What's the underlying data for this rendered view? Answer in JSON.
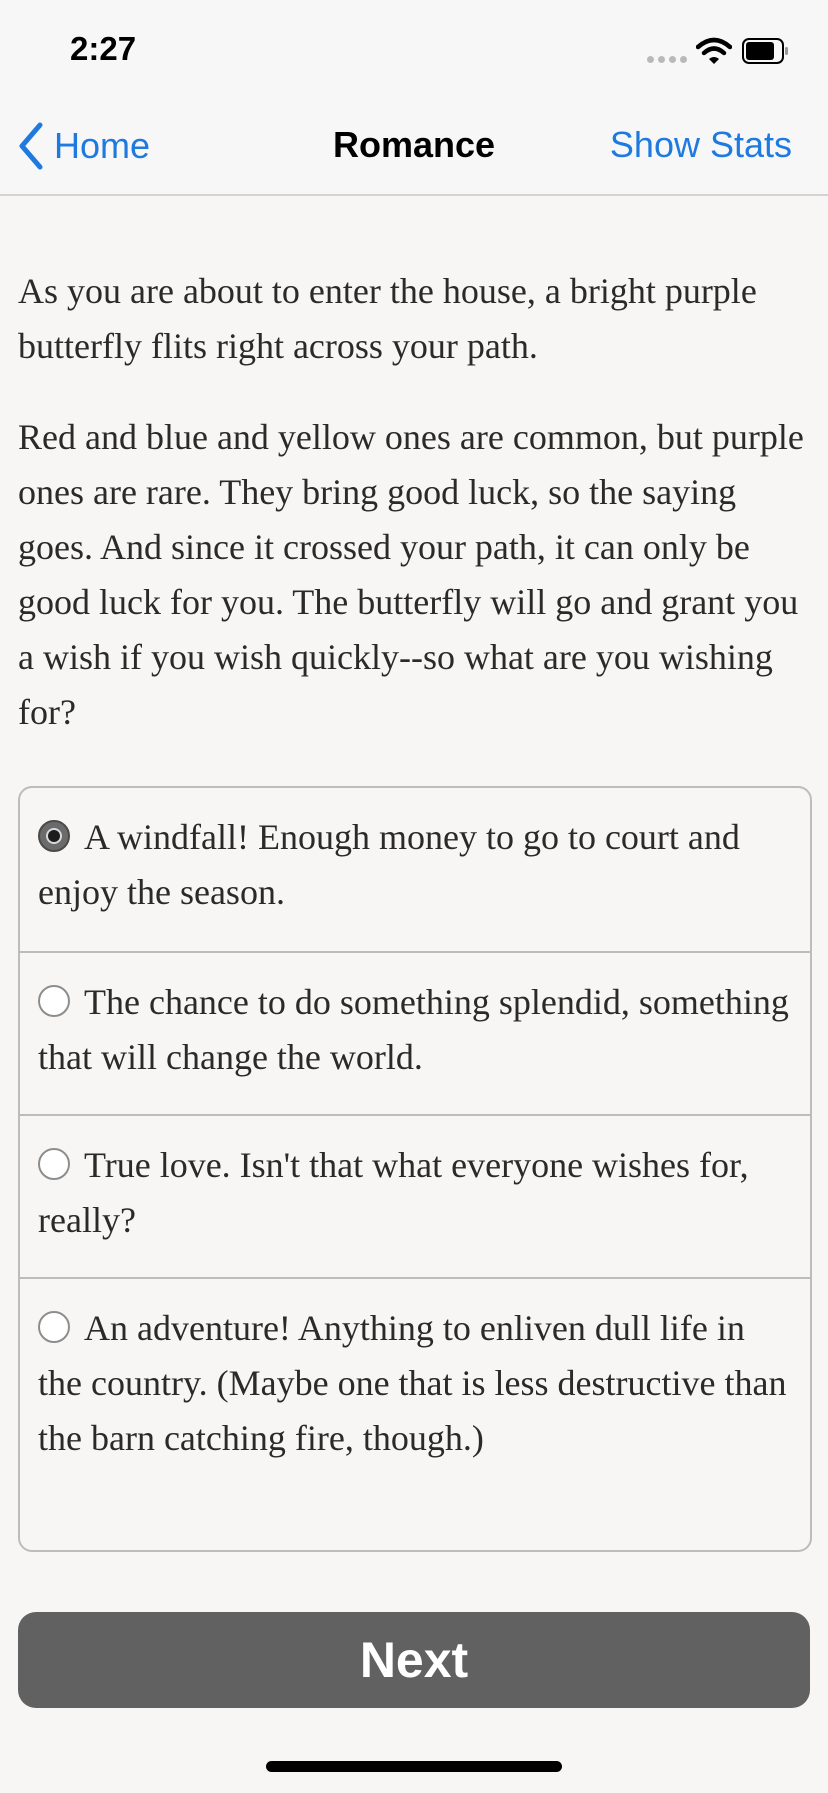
{
  "status_bar": {
    "time": "2:27"
  },
  "nav": {
    "back_label": "Home",
    "title": "Romance",
    "right_label": "Show Stats"
  },
  "story": {
    "paragraphs": [
      "As you are about to enter the house, a bright purple butterfly flits right across your path.",
      "Red and blue and yellow ones are common, but purple ones are rare. They bring good luck, so the saying goes. And since it crossed your path, it can only be good luck for you. The butterfly will go and grant you a wish if you wish quickly--so what are you wishing for?"
    ]
  },
  "choices": [
    {
      "label": "A windfall! Enough money to go to court and enjoy the season.",
      "selected": true
    },
    {
      "label": "The chance to do something splendid, something that will change the world.",
      "selected": false
    },
    {
      "label": "True love. Isn't that what everyone wishes for, really?",
      "selected": false
    },
    {
      "label": "An adventure! Anything to enliven dull life in the country. (Maybe one that is less destructive than the barn catching fire, though.)",
      "selected": false
    }
  ],
  "next_button": {
    "label": "Next"
  },
  "icons": {
    "back": "chevron-left-icon",
    "wifi": "wifi-icon",
    "battery": "battery-icon",
    "signal": "signal-dots-icon"
  },
  "colors": {
    "accent": "#1f7ae0",
    "background": "#f8f6f4",
    "button": "#616161"
  }
}
